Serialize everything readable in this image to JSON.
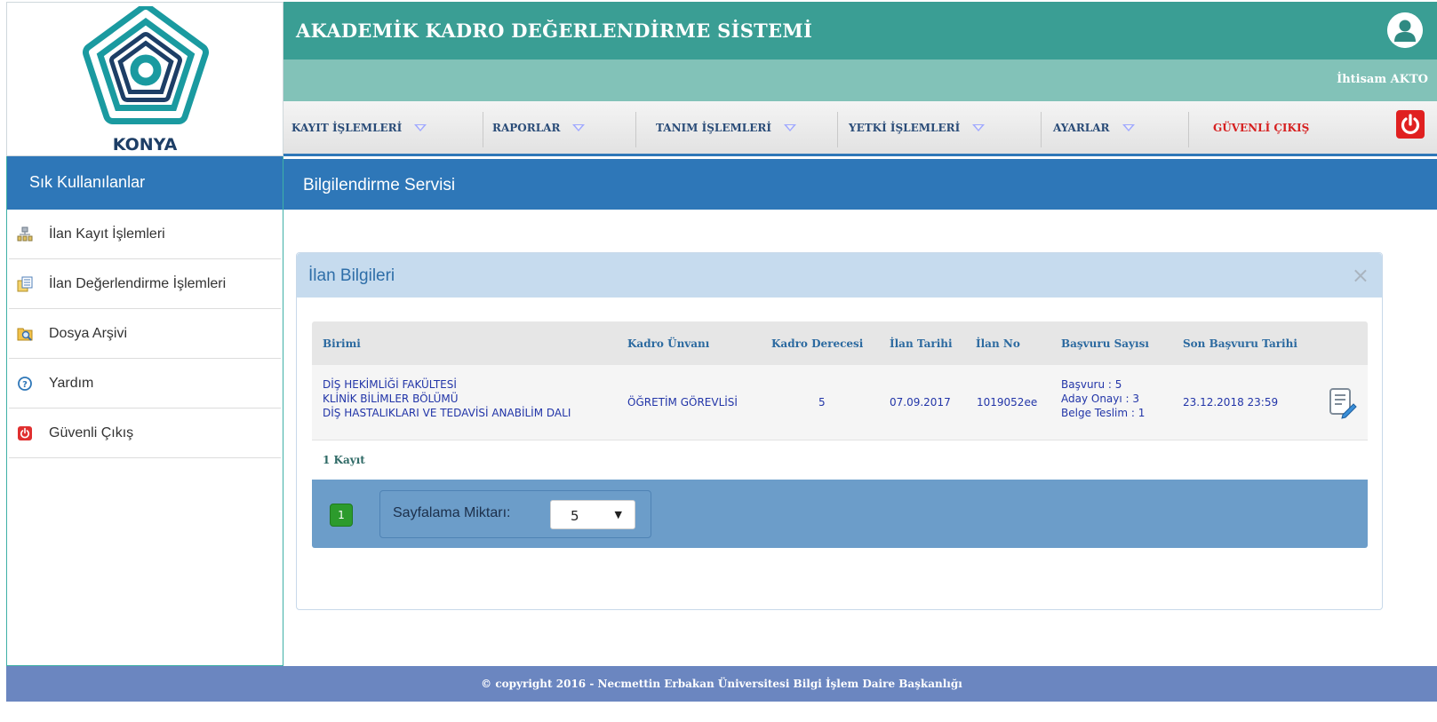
{
  "brand": {
    "logo_text": "KONYA",
    "app_title": "AKADEMİK KADRO DEĞERLENDİRME SİSTEMİ",
    "user_name": "İhtisam AKTO",
    "colors": {
      "header": "#3a9e94",
      "subheader": "#82c2b8",
      "primary": "#2e77b8",
      "danger": "#e02020",
      "footer": "#6b86c0"
    }
  },
  "nav": {
    "items": [
      {
        "label": "KAYIT İŞLEMLERİ",
        "icon": "dropdown-triangle-icon"
      },
      {
        "label": "RAPORLAR",
        "icon": "dropdown-triangle-icon"
      },
      {
        "label": "TANIM İŞLEMLERİ",
        "icon": "dropdown-triangle-icon"
      },
      {
        "label": "YETKİ İŞLEMLERİ",
        "icon": "dropdown-triangle-icon"
      },
      {
        "label": "AYARLAR",
        "icon": "dropdown-triangle-icon"
      }
    ],
    "logout_label": "GÜVENLİ ÇIKIŞ",
    "logout_icon": "power-icon"
  },
  "sidebar": {
    "title": "Sık Kullanılanlar",
    "items": [
      {
        "label": "İlan Kayıt İşlemleri",
        "icon": "sitemap-icon"
      },
      {
        "label": "İlan Değerlendirme İşlemleri",
        "icon": "documents-icon"
      },
      {
        "label": "Dosya Arşivi",
        "icon": "folder-search-icon"
      },
      {
        "label": "Yardım",
        "icon": "help-icon"
      },
      {
        "label": "Güvenli Çıkış",
        "icon": "power-icon"
      }
    ]
  },
  "main": {
    "section_title": "Bilgilendirme Servisi",
    "panel": {
      "title": "İlan Bilgileri",
      "close_symbol": "×"
    },
    "table": {
      "headers": [
        "Birimi",
        "Kadro Ünvanı",
        "Kadro Derecesi",
        "İlan Tarihi",
        "İlan No",
        "Başvuru Sayısı",
        "Son Başvuru Tarihi"
      ],
      "rows": [
        {
          "birimi": [
            "DİŞ HEKİMLİĞİ FAKÜLTESİ",
            "KLİNİK BİLİMLER BÖLÜMÜ",
            "DİŞ HASTALIKLARI VE TEDAVİSİ ANABİLİM DALI"
          ],
          "kadro_unvani": "ÖĞRETİM GÖREVLİSİ",
          "kadro_derecesi": "5",
          "ilan_tarihi": "07.09.2017",
          "ilan_no": "1019052ee",
          "basvuru_sayisi": [
            "Başvuru : 5",
            "Aday Onayı : 3",
            "Belge Teslim : 1"
          ],
          "son_basvuru_tarihi": "23.12.2018 23:59",
          "action_icon": "edit-document-icon"
        }
      ],
      "record_count": "1 Kayıt"
    },
    "pager": {
      "current_page": "1",
      "page_size_label": "Sayfalama Miktarı:",
      "page_size_value": "5",
      "arrow": "▼"
    }
  },
  "footer": {
    "text": "© copyright 2016 - Necmettin Erbakan Üniversitesi Bilgi İşlem Daire Başkanlığı"
  }
}
